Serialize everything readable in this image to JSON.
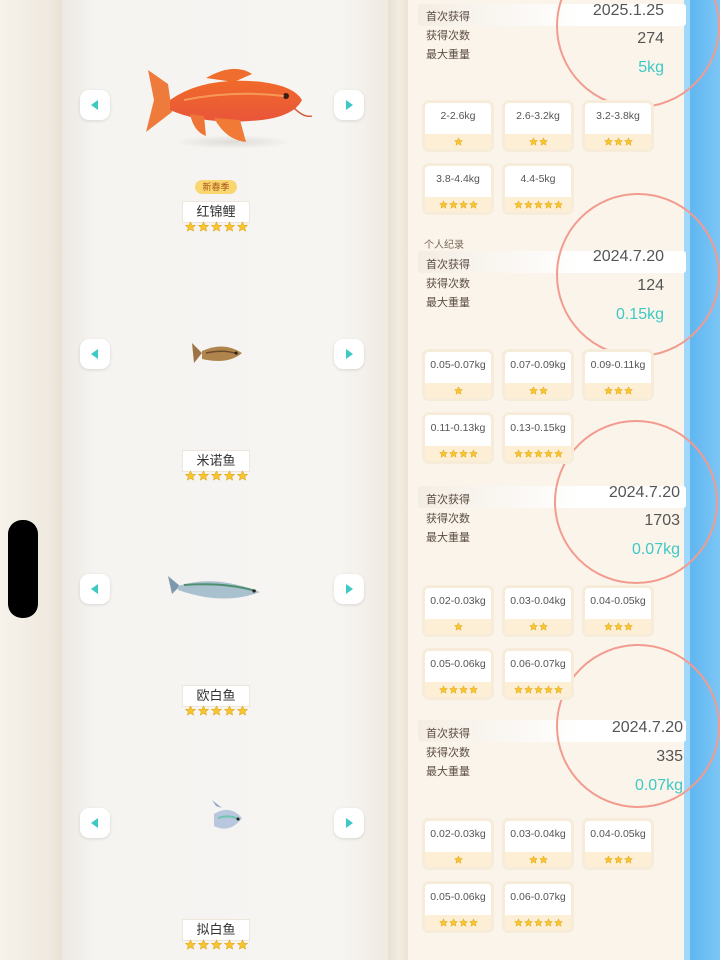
{
  "fish": [
    {
      "name": "红锦鲤",
      "badge": "新春季",
      "stars": 5,
      "icon": "koi-fish-icon"
    },
    {
      "name": "米诺鱼",
      "badge": "",
      "stars": 5,
      "icon": "minnow-fish-icon"
    },
    {
      "name": "欧白鱼",
      "badge": "",
      "stars": 5,
      "icon": "bleak-fish-icon"
    },
    {
      "name": "拟白鱼",
      "badge": "",
      "stars": 5,
      "icon": "pseudo-bleak-fish-icon"
    }
  ],
  "records": [
    {
      "section_label": "",
      "first_catch_label": "首次获得",
      "catch_count_label": "获得次数",
      "max_weight_label": "最大重量",
      "first_catch": "2025.1.25",
      "catch_count": "274",
      "max_weight": "5kg",
      "weights": [
        {
          "range": "2-2.6kg",
          "stars": 1
        },
        {
          "range": "2.6-3.2kg",
          "stars": 2
        },
        {
          "range": "3.2-3.8kg",
          "stars": 3
        },
        {
          "range": "3.8-4.4kg",
          "stars": 4
        },
        {
          "range": "4.4-5kg",
          "stars": 5
        }
      ]
    },
    {
      "section_label": "个人纪录",
      "first_catch_label": "首次获得",
      "catch_count_label": "获得次数",
      "max_weight_label": "最大重量",
      "first_catch": "2024.7.20",
      "catch_count": "124",
      "max_weight": "0.15kg",
      "weights": [
        {
          "range": "0.05-0.07kg",
          "stars": 1
        },
        {
          "range": "0.07-0.09kg",
          "stars": 2
        },
        {
          "range": "0.09-0.11kg",
          "stars": 3
        },
        {
          "range": "0.11-0.13kg",
          "stars": 4
        },
        {
          "range": "0.13-0.15kg",
          "stars": 5
        }
      ]
    },
    {
      "section_label": "",
      "first_catch_label": "首次获得",
      "catch_count_label": "获得次数",
      "max_weight_label": "最大重量",
      "first_catch": "2024.7.20",
      "catch_count": "1703",
      "max_weight": "0.07kg",
      "weights": [
        {
          "range": "0.02-0.03kg",
          "stars": 1
        },
        {
          "range": "0.03-0.04kg",
          "stars": 2
        },
        {
          "range": "0.04-0.05kg",
          "stars": 3
        },
        {
          "range": "0.05-0.06kg",
          "stars": 4
        },
        {
          "range": "0.06-0.07kg",
          "stars": 5
        }
      ]
    },
    {
      "section_label": "",
      "first_catch_label": "首次获得",
      "catch_count_label": "获得次数",
      "max_weight_label": "最大重量",
      "first_catch": "2024.7.20",
      "catch_count": "335",
      "max_weight": "0.07kg",
      "weights": [
        {
          "range": "0.02-0.03kg",
          "stars": 1
        },
        {
          "range": "0.03-0.04kg",
          "stars": 2
        },
        {
          "range": "0.04-0.05kg",
          "stars": 3
        },
        {
          "range": "0.05-0.06kg",
          "stars": 4
        },
        {
          "range": "0.06-0.07kg",
          "stars": 5
        }
      ]
    }
  ],
  "colors": {
    "accent_teal": "#3ec9c5",
    "circle_pink": "#f29b8e",
    "star_gold": "#f7c531",
    "badge_yellow": "#f9d66f"
  }
}
